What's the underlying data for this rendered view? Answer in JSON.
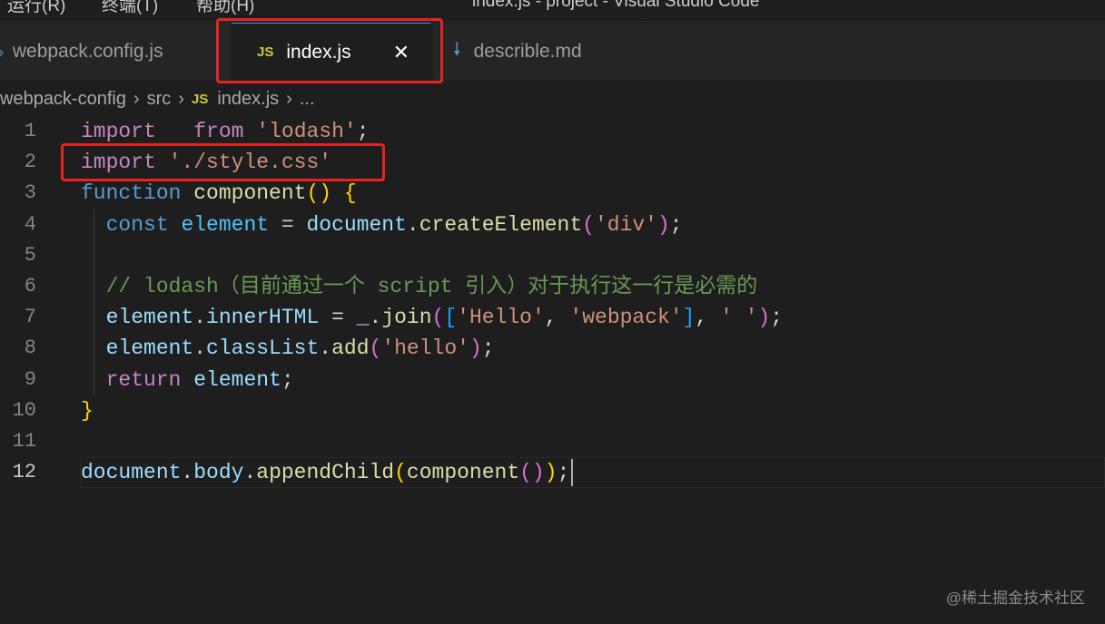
{
  "menu": [
    "运行(R)",
    "终端(T)",
    "帮助(H)"
  ],
  "window_title": "index.js - project - Visual Studio Code",
  "tabs": [
    {
      "label": "webpack.config.js"
    },
    {
      "label": "index.js",
      "icon": "JS",
      "close": "✕"
    },
    {
      "label": "describle.md"
    }
  ],
  "breadcrumb": [
    "webpack-config",
    "src",
    "index.js",
    "..."
  ],
  "breadcrumb_icon": "JS",
  "lines": [
    {
      "n": "1",
      "t": [
        [
          "import",
          "k"
        ],
        [
          "   ",
          "p"
        ],
        [
          "from",
          "k"
        ],
        [
          " ",
          "p"
        ],
        [
          "'lodash'",
          "s"
        ],
        [
          ";",
          "p"
        ]
      ]
    },
    {
      "n": "2",
      "t": [
        [
          "import",
          "k"
        ],
        [
          " ",
          "p"
        ],
        [
          "'./style.css'",
          "s"
        ]
      ]
    },
    {
      "n": "3",
      "t": [
        [
          "function",
          "b"
        ],
        [
          " ",
          "p"
        ],
        [
          "component",
          "f"
        ],
        [
          "()",
          "y"
        ],
        [
          " ",
          "p"
        ],
        [
          "{",
          "y"
        ]
      ]
    },
    {
      "n": "4",
      "t": [
        [
          "  ",
          "p"
        ],
        [
          "const",
          "b"
        ],
        [
          " ",
          "p"
        ],
        [
          "element",
          "cv"
        ],
        [
          " = ",
          "p"
        ],
        [
          "document",
          "v"
        ],
        [
          ".",
          "p"
        ],
        [
          "createElement",
          "f"
        ],
        [
          "(",
          "m"
        ],
        [
          "'div'",
          "s"
        ],
        [
          ")",
          "m"
        ],
        [
          ";",
          "p"
        ]
      ]
    },
    {
      "n": "5",
      "t": []
    },
    {
      "n": "6",
      "t": [
        [
          "  ",
          "p"
        ],
        [
          "// lodash（目前通过一个 script 引入）对于执行这一行是必需的",
          "c"
        ]
      ]
    },
    {
      "n": "7",
      "t": [
        [
          "  ",
          "p"
        ],
        [
          "element",
          "v"
        ],
        [
          ".",
          "p"
        ],
        [
          "innerHTML",
          "v"
        ],
        [
          " = ",
          "p"
        ],
        [
          "_",
          "v"
        ],
        [
          ".",
          "p"
        ],
        [
          "join",
          "f"
        ],
        [
          "(",
          "m"
        ],
        [
          "[",
          "l"
        ],
        [
          "'Hello'",
          "s"
        ],
        [
          ", ",
          "p"
        ],
        [
          "'webpack'",
          "s"
        ],
        [
          "]",
          "l"
        ],
        [
          ", ",
          "p"
        ],
        [
          "' '",
          "s"
        ],
        [
          ")",
          "m"
        ],
        [
          ";",
          "p"
        ]
      ]
    },
    {
      "n": "8",
      "t": [
        [
          "  ",
          "p"
        ],
        [
          "element",
          "v"
        ],
        [
          ".",
          "p"
        ],
        [
          "classList",
          "v"
        ],
        [
          ".",
          "p"
        ],
        [
          "add",
          "f"
        ],
        [
          "(",
          "m"
        ],
        [
          "'hello'",
          "s"
        ],
        [
          ")",
          "m"
        ],
        [
          ";",
          "p"
        ]
      ]
    },
    {
      "n": "9",
      "t": [
        [
          "  ",
          "p"
        ],
        [
          "return",
          "k"
        ],
        [
          " ",
          "p"
        ],
        [
          "element",
          "v"
        ],
        [
          ";",
          "p"
        ]
      ]
    },
    {
      "n": "10",
      "t": [
        [
          "}",
          "y"
        ]
      ]
    },
    {
      "n": "11",
      "t": []
    },
    {
      "n": "12",
      "t": [
        [
          "document",
          "v"
        ],
        [
          ".",
          "p"
        ],
        [
          "body",
          "v"
        ],
        [
          ".",
          "p"
        ],
        [
          "appendChild",
          "f"
        ],
        [
          "(",
          "y"
        ],
        [
          "component",
          "f"
        ],
        [
          "(",
          "m"
        ],
        [
          ")",
          "m"
        ],
        [
          ")",
          "y"
        ],
        [
          ";",
          "p"
        ]
      ]
    }
  ],
  "current_line": "12",
  "watermark": "@稀土掘金技术社区",
  "colors": {
    "highlight": "#e8231f",
    "background": "#1e1e1e"
  }
}
